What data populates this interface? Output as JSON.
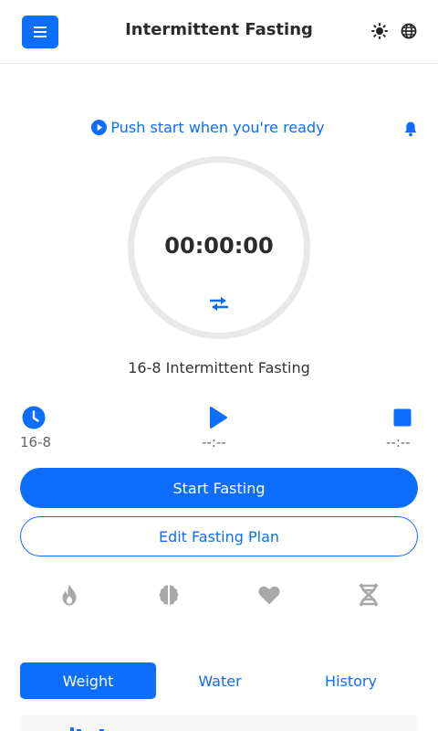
{
  "header": {
    "title": "Intermittent Fasting",
    "menu_icon": "hamburger-menu-icon",
    "theme_icon": "sun-icon",
    "language_icon": "globe-icon"
  },
  "status": {
    "text": "Push start when you're ready",
    "icon": "play-circle-icon",
    "notification_icon": "bell-icon"
  },
  "timer": {
    "display": "00:00:00",
    "progress": 0,
    "swap_icon": "swap-arrows-icon"
  },
  "plan": {
    "name": "16-8 Intermittent Fasting"
  },
  "stats": {
    "plan_label": "16-8",
    "start_time": "--:--",
    "end_time": "--:--"
  },
  "actions": {
    "start_label": "Start Fasting",
    "edit_label": "Edit Fasting Plan"
  },
  "stages": [
    {
      "icon": "fire-icon"
    },
    {
      "icon": "brain-icon"
    },
    {
      "icon": "heart-icon"
    },
    {
      "icon": "dna-icon"
    }
  ],
  "tabs": [
    {
      "label": "Weight",
      "active": true
    },
    {
      "label": "Water",
      "active": false
    },
    {
      "label": "History",
      "active": false
    }
  ],
  "colors": {
    "primary": "#0d6efd",
    "stage_icon": "#a8a8a8",
    "ring": "#e8e8e8"
  }
}
